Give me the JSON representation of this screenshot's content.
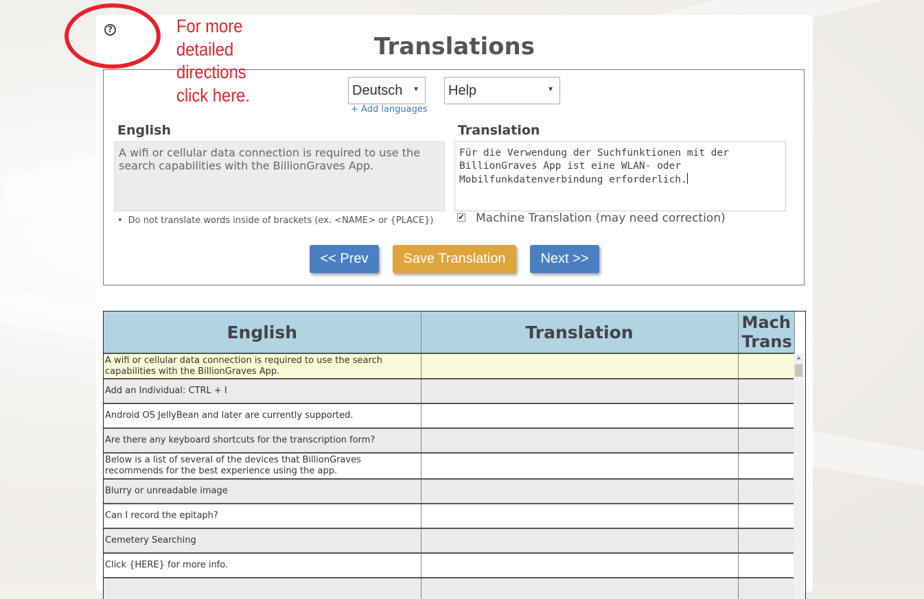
{
  "annotation": {
    "text_lines": [
      "For more",
      "detailed",
      "directions",
      "click here."
    ],
    "color": "#e5232b"
  },
  "page": {
    "title": "Translations"
  },
  "editor": {
    "language_select": {
      "value": "Deutsch"
    },
    "category_select": {
      "value": "Help"
    },
    "add_languages_link": "+ Add languages",
    "english_label": "English",
    "translation_label": "Translation",
    "source_text": "A wifi or cellular data connection is required to use the search capabilities with the BillionGraves App.",
    "translation_lines": [
      "Für die Verwendung der Suchfunktionen mit der",
      "BillionGraves App ist eine WLAN- oder",
      "Mobilfunkdatenverbindung erforderlich."
    ],
    "note": "Do not translate words inside of brackets (ex. <NAME> or {PLACE})",
    "machine_translation": {
      "checked": true,
      "label": "Machine Translation (may need correction)"
    },
    "buttons": {
      "prev": "<< Prev",
      "save": "Save Translation",
      "next": "Next >>"
    }
  },
  "table": {
    "headers": {
      "english": "English",
      "translation": "Translation",
      "mach_line1": "Mach",
      "mach_line2": "Trans"
    },
    "rows": [
      {
        "english": "A wifi or cellular data connection is required to use the search capabilities with the BillionGraves App.",
        "translation": "",
        "mach": ""
      },
      {
        "english": "Add an Individual: CTRL + I",
        "translation": "",
        "mach": ""
      },
      {
        "english": "Android OS JellyBean and later are currently supported.",
        "translation": "",
        "mach": ""
      },
      {
        "english": "Are there any keyboard shortcuts for the transcription form?",
        "translation": "",
        "mach": ""
      },
      {
        "english": "Below is a list of several of the devices that BillionGraves recommends for the best experience using the app.",
        "translation": "",
        "mach": ""
      },
      {
        "english": "Blurry or unreadable image",
        "translation": "",
        "mach": ""
      },
      {
        "english": "Can I record the epitaph?",
        "translation": "",
        "mach": ""
      },
      {
        "english": "Cemetery Searching",
        "translation": "",
        "mach": ""
      },
      {
        "english": "Click {HERE} for more info.",
        "translation": "",
        "mach": ""
      }
    ]
  },
  "colors": {
    "header_bg": "#b0d4e3",
    "primary_button": "#4a7fc3",
    "save_button": "#dfa43c",
    "selected_row": "#fafad8"
  }
}
